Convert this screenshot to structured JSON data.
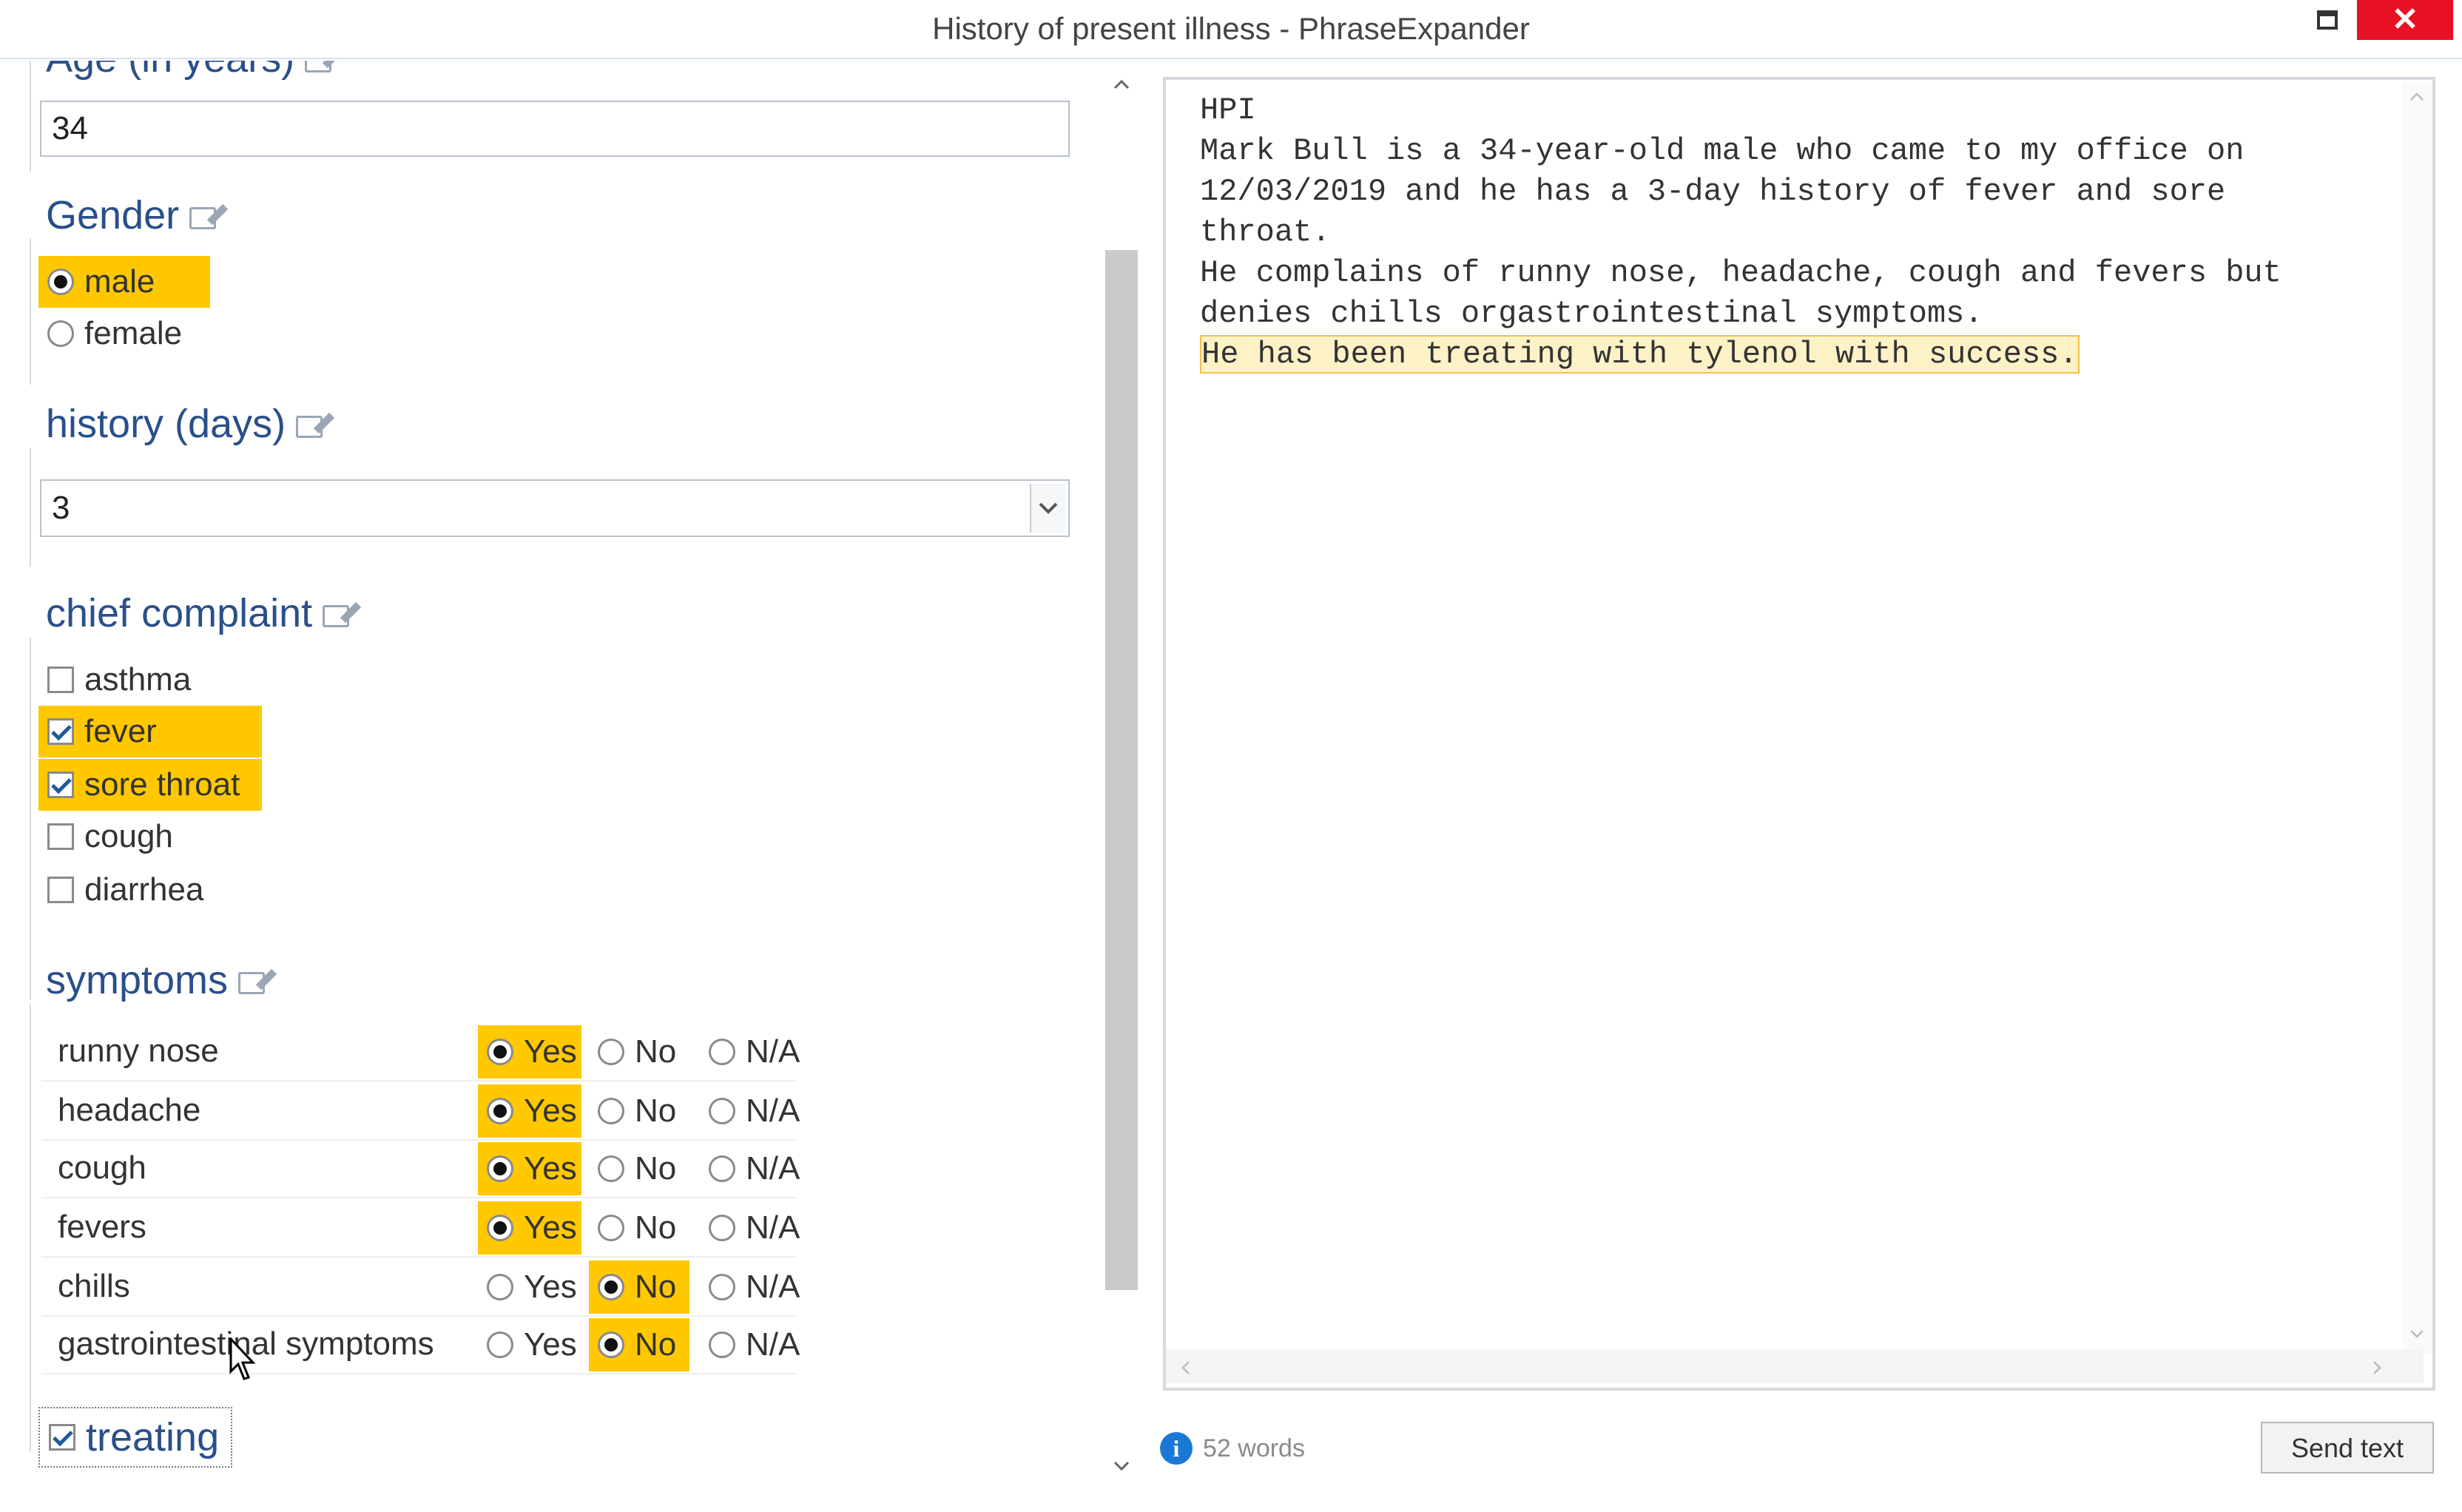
{
  "window": {
    "title": "History of present illness - PhraseExpander",
    "close_glyph": "✕"
  },
  "form": {
    "age": {
      "label": "Age (in years)",
      "value": "34"
    },
    "gender": {
      "label": "Gender",
      "options": [
        {
          "label": "male",
          "selected": true
        },
        {
          "label": "female",
          "selected": false
        }
      ]
    },
    "history": {
      "label": "history (days)",
      "value": "3"
    },
    "chief_complaint": {
      "label": "chief complaint",
      "options": [
        {
          "label": "asthma",
          "checked": false
        },
        {
          "label": "fever",
          "checked": true
        },
        {
          "label": "sore throat",
          "checked": true
        },
        {
          "label": "cough",
          "checked": false
        },
        {
          "label": "diarrhea",
          "checked": false
        }
      ]
    },
    "symptoms": {
      "label": "symptoms",
      "choices": [
        "Yes",
        "No",
        "N/A"
      ],
      "rows": [
        {
          "label": "runny nose",
          "value": "Yes"
        },
        {
          "label": "headache",
          "value": "Yes"
        },
        {
          "label": "cough",
          "value": "Yes"
        },
        {
          "label": "fevers",
          "value": "Yes"
        },
        {
          "label": "chills",
          "value": "No"
        },
        {
          "label": "gastrointestinal symptoms",
          "value": "No"
        }
      ]
    },
    "treating": {
      "label": "treating",
      "checked": true
    }
  },
  "preview": {
    "lines": [
      "HPI",
      "Mark Bull is a 34-year-old male who came to my office on",
      "12/03/2019 and he has a 3-day history of fever and sore",
      "throat.",
      "He complains of runny nose, headache, cough and fevers but",
      "denies chills orgastrointestinal symptoms."
    ],
    "highlighted_line": "He has been treating with tylenol with success."
  },
  "footer": {
    "info_glyph": "i",
    "word_count": "52 words",
    "send_label": "Send text"
  },
  "colors": {
    "highlight": "#ffc800",
    "title_blue": "#2a4f8a",
    "close_red": "#e81123"
  }
}
